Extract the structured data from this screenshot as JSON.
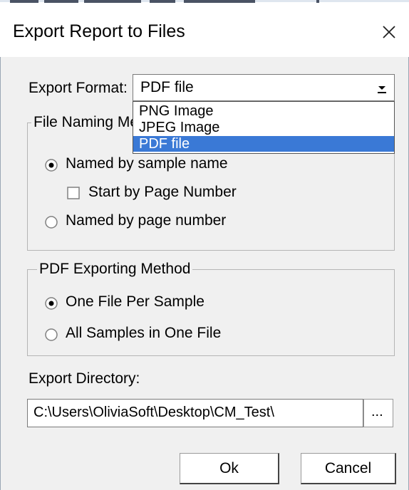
{
  "window": {
    "title": "Export Report to Files",
    "close_glyph": "✕"
  },
  "export_format": {
    "label": "Export Format:",
    "value": "PDF file",
    "options": [
      "PNG Image",
      "JPEG Image",
      "PDF file"
    ],
    "selected_index": 2
  },
  "naming_group": {
    "label": "File Naming Me",
    "option_sample": "Named by sample name",
    "option_sample_checked": true,
    "start_by_page": "Start by Page Number",
    "start_by_page_checked": false,
    "option_page": "Named by page number",
    "option_page_checked": false
  },
  "pdf_method": {
    "label": "PDF Exporting Method",
    "option_one": "One File Per Sample",
    "option_one_checked": true,
    "option_all": "All Samples in One File",
    "option_all_checked": false
  },
  "export_directory": {
    "label": "Export Directory:",
    "value": "C:\\Users\\OliviaSoft\\Desktop\\CM_Test\\",
    "browse_label": "..."
  },
  "buttons": {
    "ok": "Ok",
    "cancel": "Cancel"
  },
  "colors": {
    "selection": "#3a79d6",
    "client_bg": "#f0f0f0"
  }
}
